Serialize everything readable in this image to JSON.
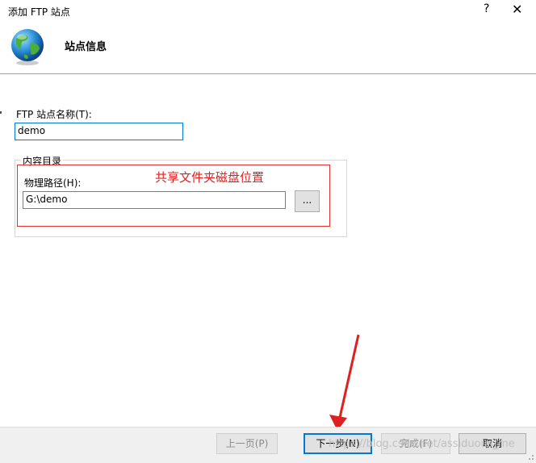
{
  "window": {
    "title": "添加 FTP 站点",
    "help_label": "?",
    "close_label": "✕"
  },
  "header": {
    "title": "站点信息",
    "icon": "globe-icon"
  },
  "form": {
    "site_name_label": "FTP 站点名称(T):",
    "site_name_value": "demo",
    "content_dir_legend": "内容目录",
    "physical_path_label": "物理路径(H):",
    "physical_path_value": "G:\\demo",
    "browse_label": "..."
  },
  "annotation": {
    "text": "共享文件夹磁盘位置",
    "color": "#e02020"
  },
  "buttons": {
    "prev": "上一页(P)",
    "next": "下一步(N)",
    "finish": "完成(F)",
    "cancel": "取消"
  },
  "watermark": "https://blog.csdn.net/assiduous_me",
  "colors": {
    "accent": "#0078d7",
    "annotation_red": "#e02020"
  }
}
